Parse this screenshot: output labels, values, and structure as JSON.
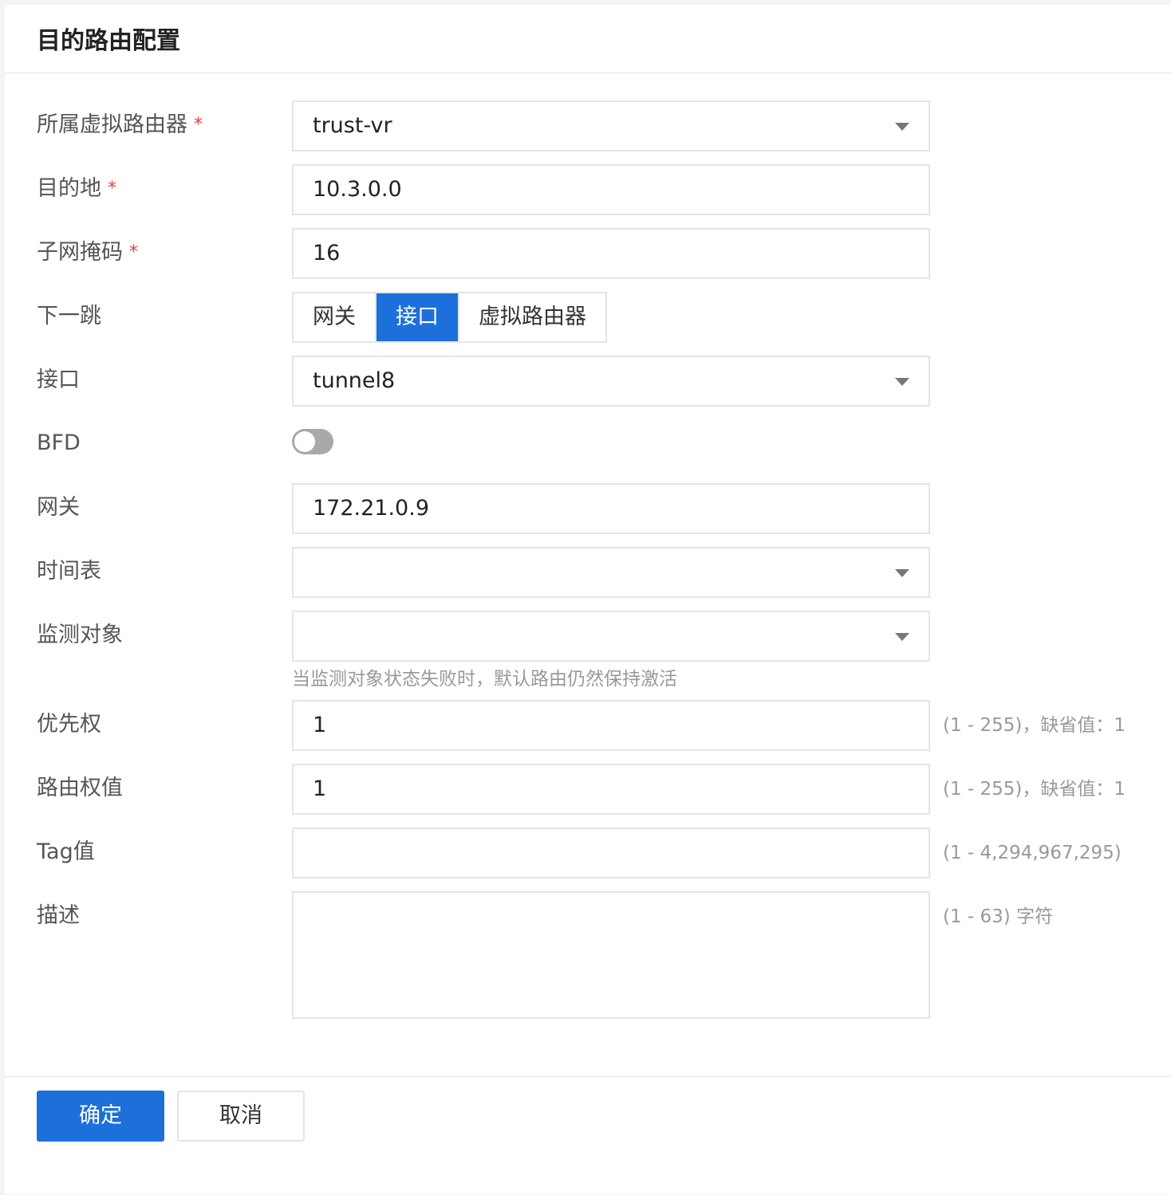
{
  "dialog": {
    "title": "目的路由配置",
    "required_mark": "*",
    "fields": {
      "virtual_router": {
        "label": "所属虚拟路由器",
        "value": "trust-vr"
      },
      "destination": {
        "label": "目的地",
        "value": "10.3.0.0"
      },
      "subnet_mask": {
        "label": "子网掩码",
        "value": "16"
      },
      "next_hop": {
        "label": "下一跳",
        "options": [
          "网关",
          "接口",
          "虚拟路由器"
        ],
        "selected": "接口"
      },
      "interface": {
        "label": "接口",
        "value": "tunnel8"
      },
      "bfd": {
        "label": "BFD",
        "enabled": false
      },
      "gateway": {
        "label": "网关",
        "value": "172.21.0.9"
      },
      "schedule": {
        "label": "时间表",
        "value": ""
      },
      "monitor": {
        "label": "监测对象",
        "value": "",
        "hint": "当监测对象状态失败时，默认路由仍然保持激活"
      },
      "priority": {
        "label": "优先权",
        "value": "1",
        "hint": "(1 - 255)，缺省值：1"
      },
      "route_weight": {
        "label": "路由权值",
        "value": "1",
        "hint": "(1 - 255)，缺省值：1"
      },
      "tag": {
        "label": "Tag值",
        "value": "",
        "hint": "(1 - 4,294,967,295)"
      },
      "description": {
        "label": "描述",
        "value": "",
        "hint": "(1 - 63) 字符"
      }
    },
    "footer": {
      "confirm_label": "确定",
      "cancel_label": "取消"
    }
  },
  "colors": {
    "primary": "#1d6fdc",
    "required": "#e4393c",
    "border": "#e3e5e9",
    "hint": "#999999"
  }
}
